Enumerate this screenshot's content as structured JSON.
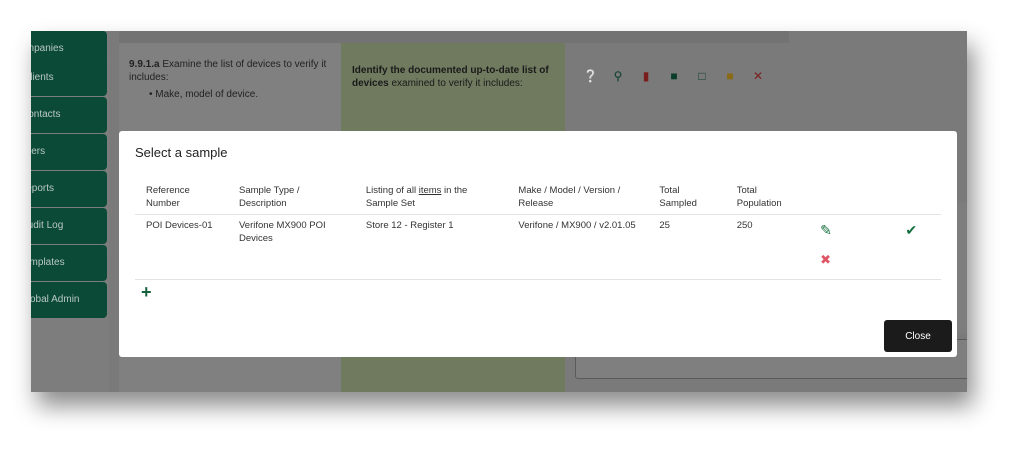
{
  "sidebar": {
    "items": [
      {
        "label": "Companies"
      },
      {
        "label": "Clients"
      },
      {
        "label": "Contacts"
      },
      {
        "label": "Users"
      },
      {
        "label": "Reports"
      },
      {
        "label": "Audit Log"
      },
      {
        "label": "Templates"
      },
      {
        "label": "Global Admin"
      }
    ]
  },
  "background": {
    "requirement_id": "9.9.1.a",
    "requirement_text": " Examine the list of devices to verify it includes:",
    "requirement_bullet": "Make, model of device.",
    "guidance_bold": "Identify the documented up-to-date list of devices",
    "guidance_rest": " examined to verify it includes:",
    "toolbar_icons": [
      "help-icon",
      "search-icon",
      "clipboard-icon",
      "comments-icon",
      "comment-icon",
      "note-icon",
      "close-icon"
    ]
  },
  "modal": {
    "title": "Select a sample",
    "columns": [
      "Reference Number",
      "Sample Type / Description",
      "Listing of all items in the Sample Set",
      "Make / Model / Version / Release",
      "Total Sampled",
      "Total Population"
    ],
    "rows": [
      {
        "reference": "POI Devices-01",
        "type": "Verifone MX900 POI Devices",
        "listing": "Store 12 - Register 1",
        "make": "Verifone / MX900 / v2.01.05",
        "sampled": "25",
        "population": "250"
      }
    ],
    "add_label": "+",
    "close_label": "Close"
  },
  "colors": {
    "accent": "#156f3e",
    "danger": "#e05565",
    "sidebar": "#0c4a38",
    "close_button": "#1b1b1b"
  }
}
